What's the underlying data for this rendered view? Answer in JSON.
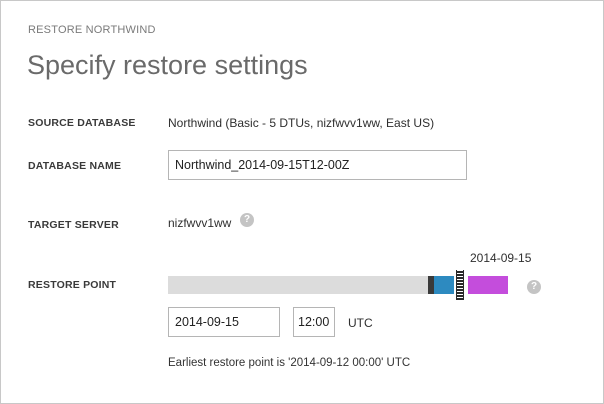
{
  "dialog": {
    "eyebrow": "RESTORE NORTHWIND",
    "title": "Specify restore settings"
  },
  "source_database": {
    "label": "SOURCE DATABASE",
    "value": "Northwind (Basic - 5 DTUs, nizfwvv1ww, East US)"
  },
  "database_name": {
    "label": "DATABASE NAME",
    "value": "Northwind_2014-09-15T12-00Z"
  },
  "target_server": {
    "label": "TARGET SERVER",
    "value": "nizfwvv1ww",
    "help_icon": "question-circle-icon"
  },
  "restore_point": {
    "label": "RESTORE POINT",
    "timeline_end_label": "2014-09-15",
    "date_value": "2014-09-15",
    "time_value": "12:00",
    "timezone": "UTC",
    "help_icon": "question-circle-icon",
    "note": "Earliest restore point is '2014-09-12 00:00' UTC",
    "colors": {
      "track": "#dcdcdc",
      "blue": "#2d8ac0",
      "purple": "#c44ddc",
      "dark": "#3a3a3a"
    }
  }
}
